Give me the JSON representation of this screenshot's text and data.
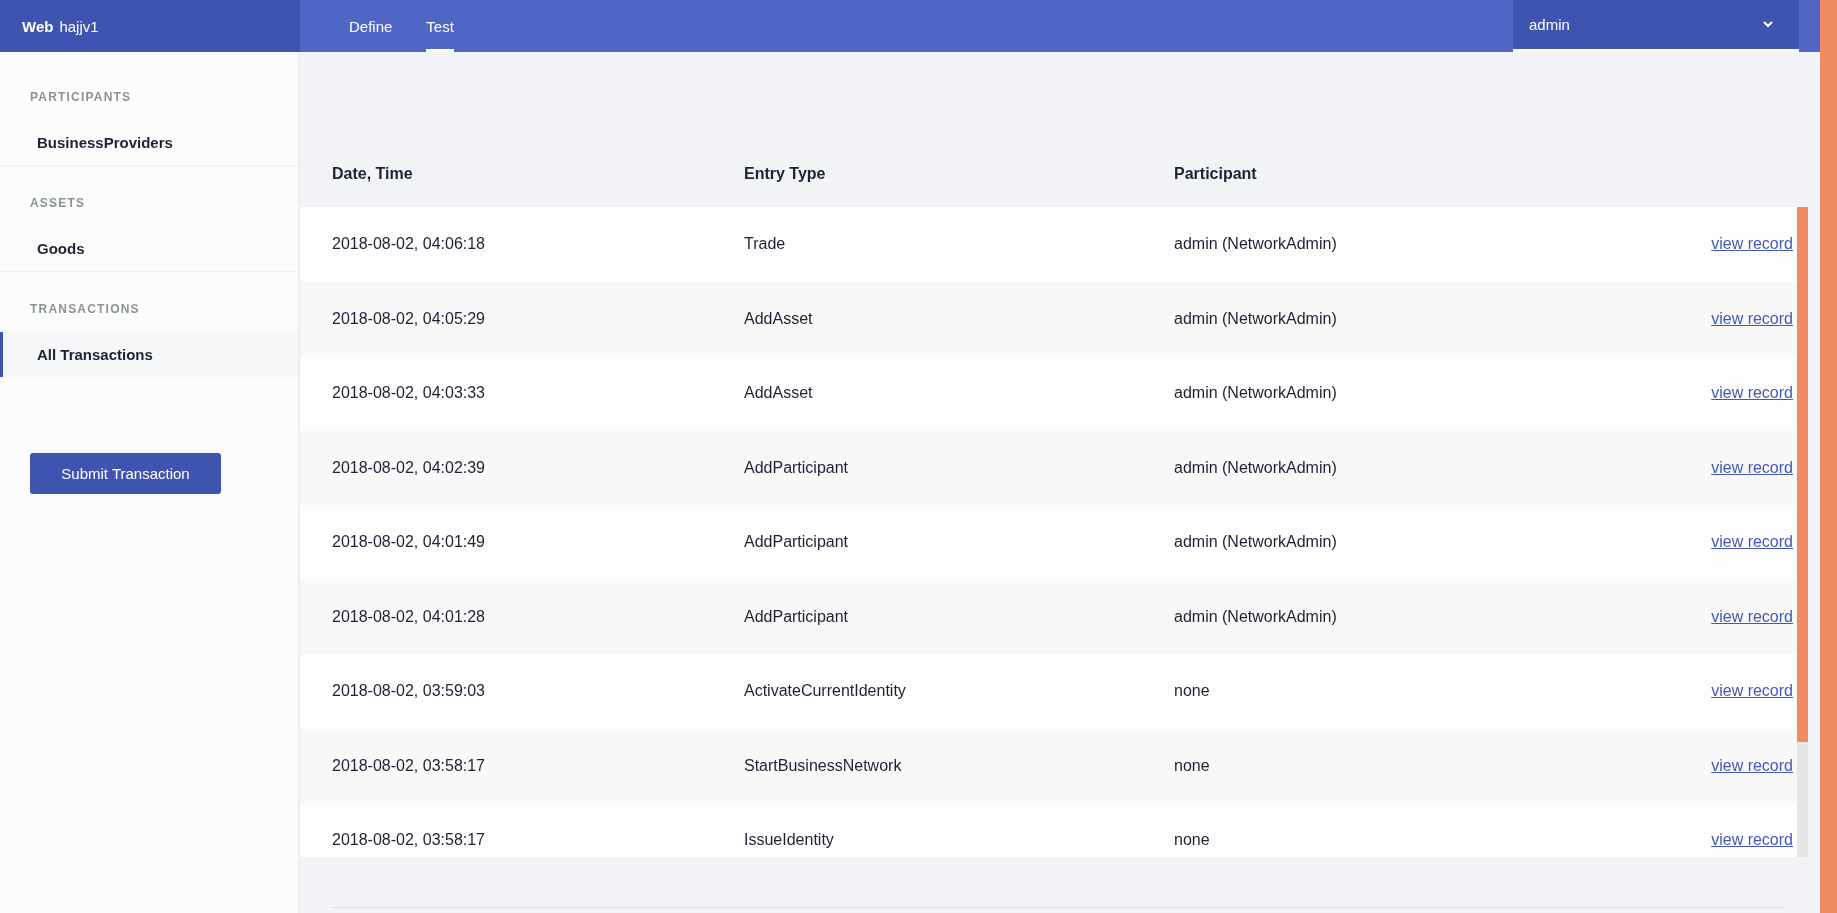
{
  "brand": {
    "bold": "Web",
    "name": "hajjv1"
  },
  "tabs": [
    {
      "label": "Define",
      "selected": false
    },
    {
      "label": "Test",
      "selected": true
    }
  ],
  "user_menu": {
    "value": "admin"
  },
  "sidebar": {
    "sections": [
      {
        "heading": "PARTICIPANTS",
        "items": [
          {
            "label": "BusinessProviders",
            "selected": false
          }
        ]
      },
      {
        "heading": "ASSETS",
        "items": [
          {
            "label": "Goods",
            "selected": false
          }
        ]
      },
      {
        "heading": "TRANSACTIONS",
        "items": [
          {
            "label": "All Transactions",
            "selected": true
          }
        ]
      }
    ],
    "button": "Submit Transaction"
  },
  "table": {
    "columns": [
      "Date, Time",
      "Entry Type",
      "Participant"
    ],
    "rows": [
      {
        "date": "2018-08-02, 04:06:18",
        "type": "Trade",
        "participant": "admin (NetworkAdmin)",
        "link": "view record"
      },
      {
        "date": "2018-08-02, 04:05:29",
        "type": "AddAsset",
        "participant": "admin (NetworkAdmin)",
        "link": "view record"
      },
      {
        "date": "2018-08-02, 04:03:33",
        "type": "AddAsset",
        "participant": "admin (NetworkAdmin)",
        "link": "view record"
      },
      {
        "date": "2018-08-02, 04:02:39",
        "type": "AddParticipant",
        "participant": "admin (NetworkAdmin)",
        "link": "view record"
      },
      {
        "date": "2018-08-02, 04:01:49",
        "type": "AddParticipant",
        "participant": "admin (NetworkAdmin)",
        "link": "view record"
      },
      {
        "date": "2018-08-02, 04:01:28",
        "type": "AddParticipant",
        "participant": "admin (NetworkAdmin)",
        "link": "view record"
      },
      {
        "date": "2018-08-02, 03:59:03",
        "type": "ActivateCurrentIdentity",
        "participant": "none",
        "link": "view record"
      },
      {
        "date": "2018-08-02, 03:58:17",
        "type": "StartBusinessNetwork",
        "participant": "none",
        "link": "view record"
      },
      {
        "date": "2018-08-02, 03:58:17",
        "type": "IssueIdentity",
        "participant": "none",
        "link": "view record"
      }
    ]
  }
}
